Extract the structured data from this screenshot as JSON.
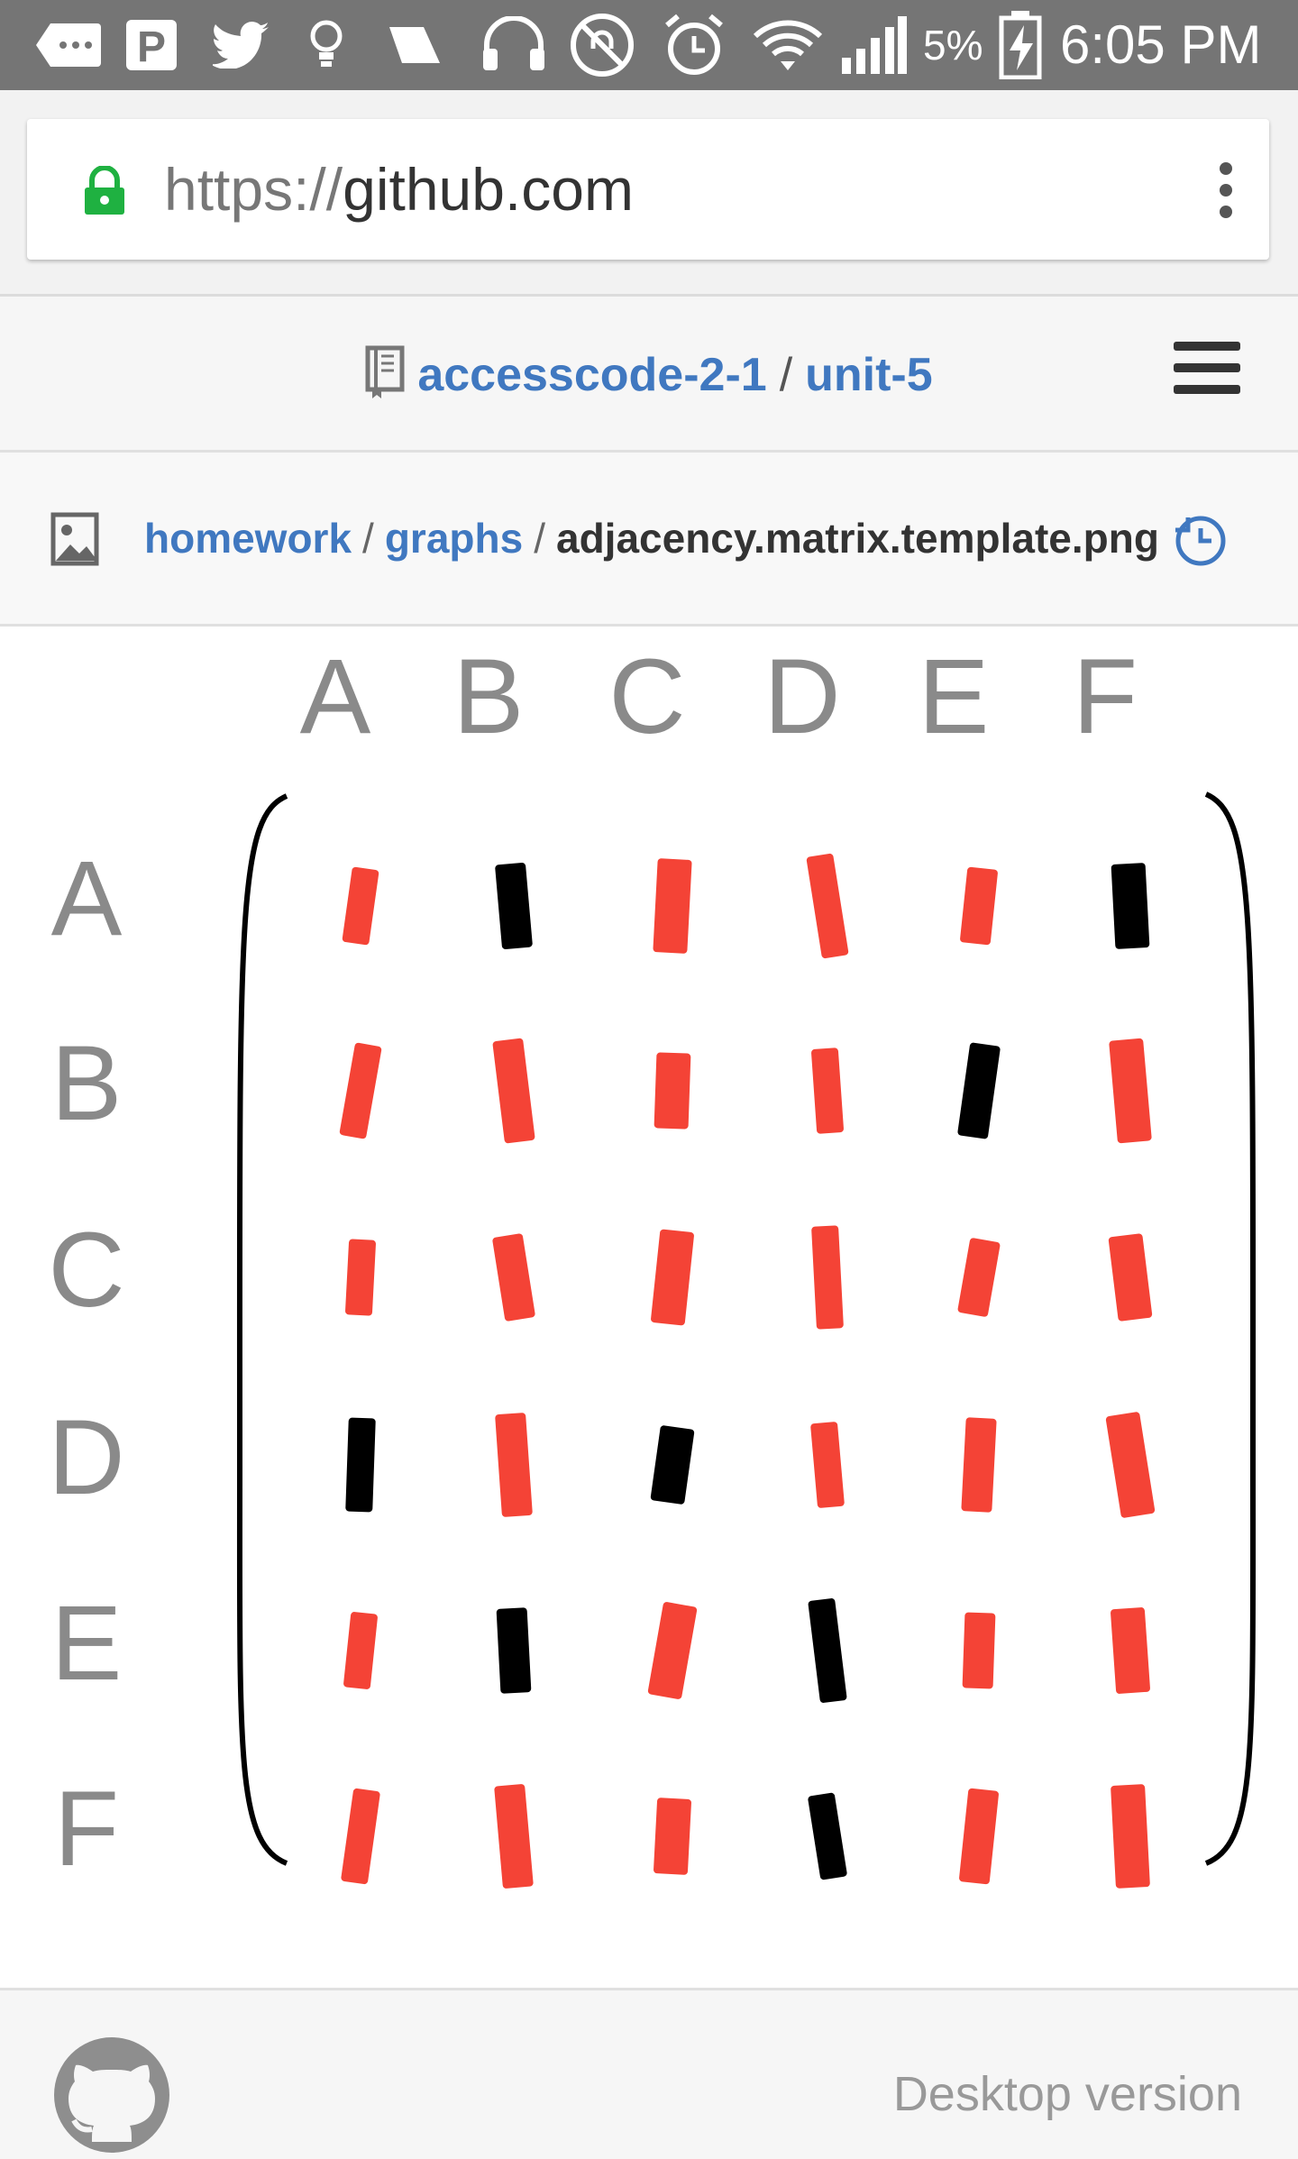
{
  "status_bar": {
    "battery_percent": "5%",
    "time": "6:05 PM",
    "icons": [
      "more-icon",
      "parking-app-icon",
      "twitter-icon",
      "lightbulb-icon",
      "flag-icon",
      "headset-icon",
      "do-not-disturb-icon",
      "alarm-icon",
      "wifi-icon",
      "signal-icon",
      "battery-charging-icon"
    ]
  },
  "browser": {
    "url_scheme": "https://",
    "url_host": "github.com"
  },
  "repo": {
    "owner": "accesscode-2-1",
    "separator": "/",
    "name": "unit-5"
  },
  "breadcrumb": {
    "items": [
      "homework",
      "graphs"
    ],
    "separator": "/",
    "file": "adjacency.matrix.template.png"
  },
  "matrix_image": {
    "column_labels": [
      "A",
      "B",
      "C",
      "D",
      "E",
      "F"
    ],
    "row_labels": [
      "A",
      "B",
      "C",
      "D",
      "E",
      "F"
    ],
    "cells": [
      [
        "red",
        "black",
        "red",
        "red",
        "red",
        "black"
      ],
      [
        "red",
        "red",
        "red",
        "red",
        "black",
        "red"
      ],
      [
        "red",
        "red",
        "red",
        "red",
        "red",
        "red"
      ],
      [
        "black",
        "red",
        "black",
        "red",
        "red",
        "red"
      ],
      [
        "red",
        "black",
        "red",
        "black",
        "red",
        "red"
      ],
      [
        "red",
        "red",
        "red",
        "black",
        "red",
        "red"
      ]
    ],
    "colors": {
      "red": "#f44336",
      "black": "#000000",
      "label": "#8a8a8a"
    }
  },
  "footer": {
    "desktop_link": "Desktop version"
  },
  "colors": {
    "link": "#4078c0",
    "status_bar": "#757575",
    "lock": "#1fb141"
  }
}
